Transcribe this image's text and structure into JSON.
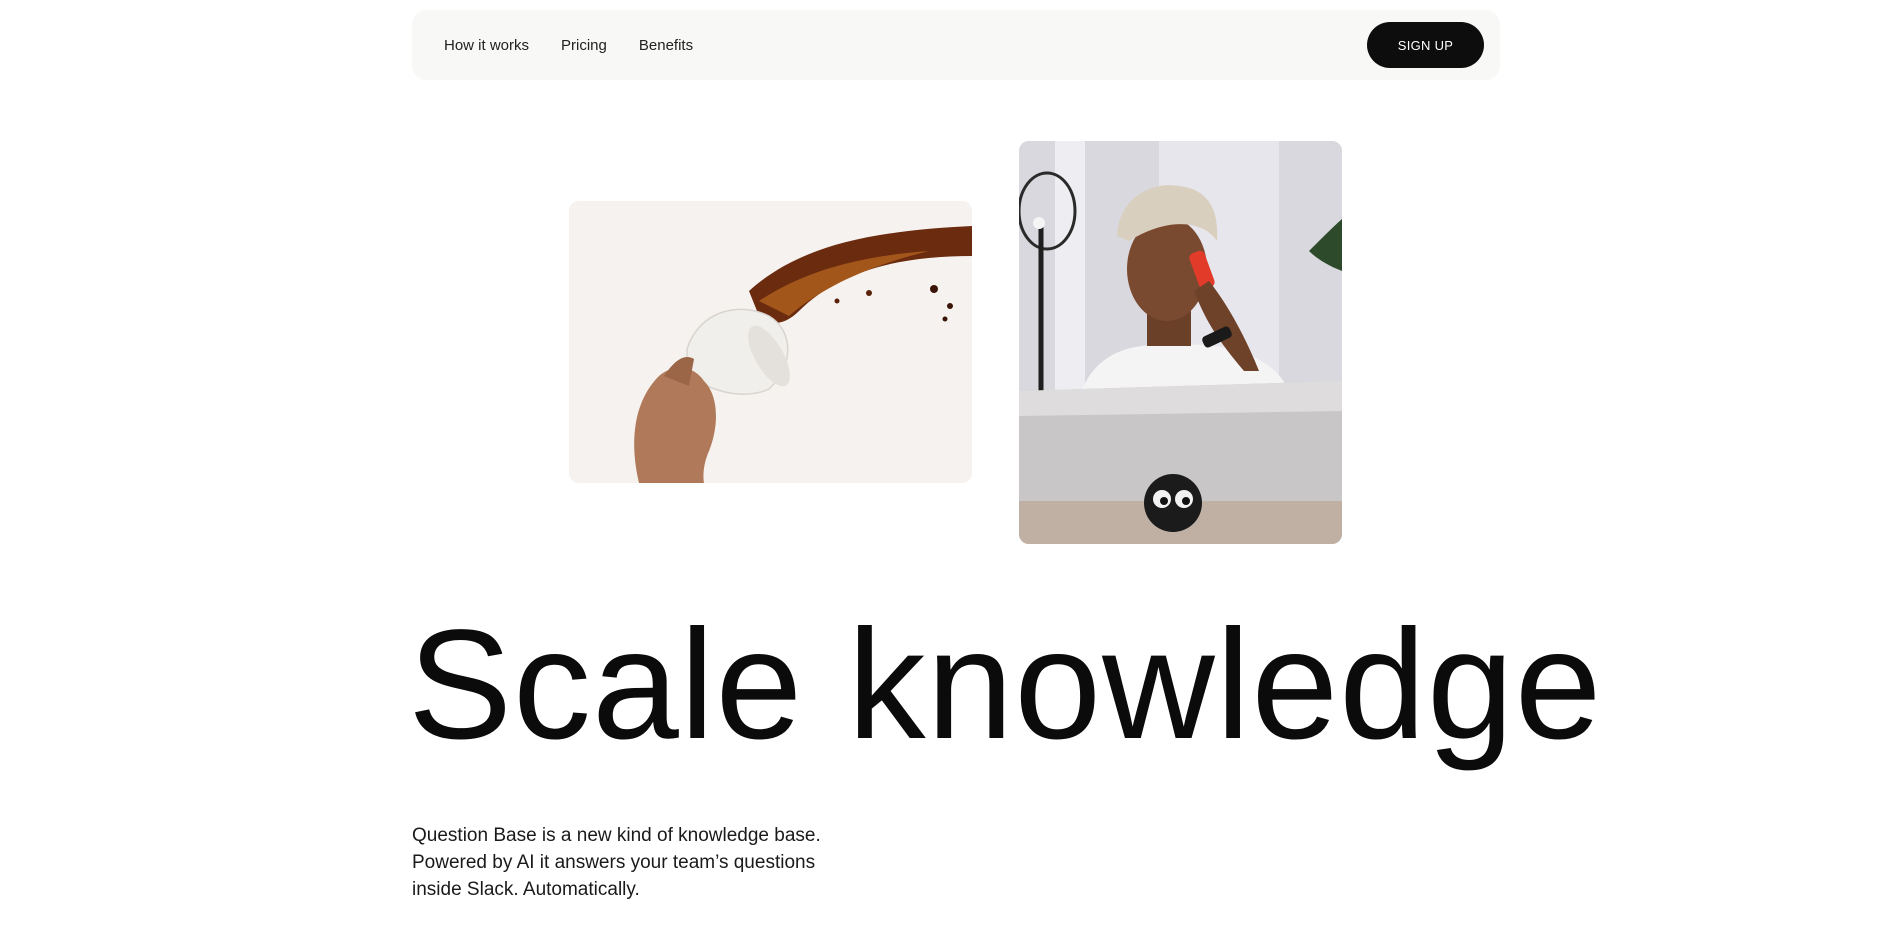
{
  "nav": {
    "links": [
      "How it works",
      "Pricing",
      "Benefits"
    ],
    "signup_label": "SIGN UP"
  },
  "hero": {
    "title": "Scale knowledge",
    "subtitle_lines": [
      "Question Base is a new kind of knowledge base.",
      "Powered by AI it answers your team’s questions",
      "inside Slack. Automatically."
    ]
  },
  "images": {
    "left": "coffee-spill-photo",
    "right": "man-on-phone-with-laptop-photo"
  },
  "colors": {
    "nav_bg": "#f8f8f7",
    "button_bg": "#0d0d0d",
    "text": "#0b0b0b"
  }
}
